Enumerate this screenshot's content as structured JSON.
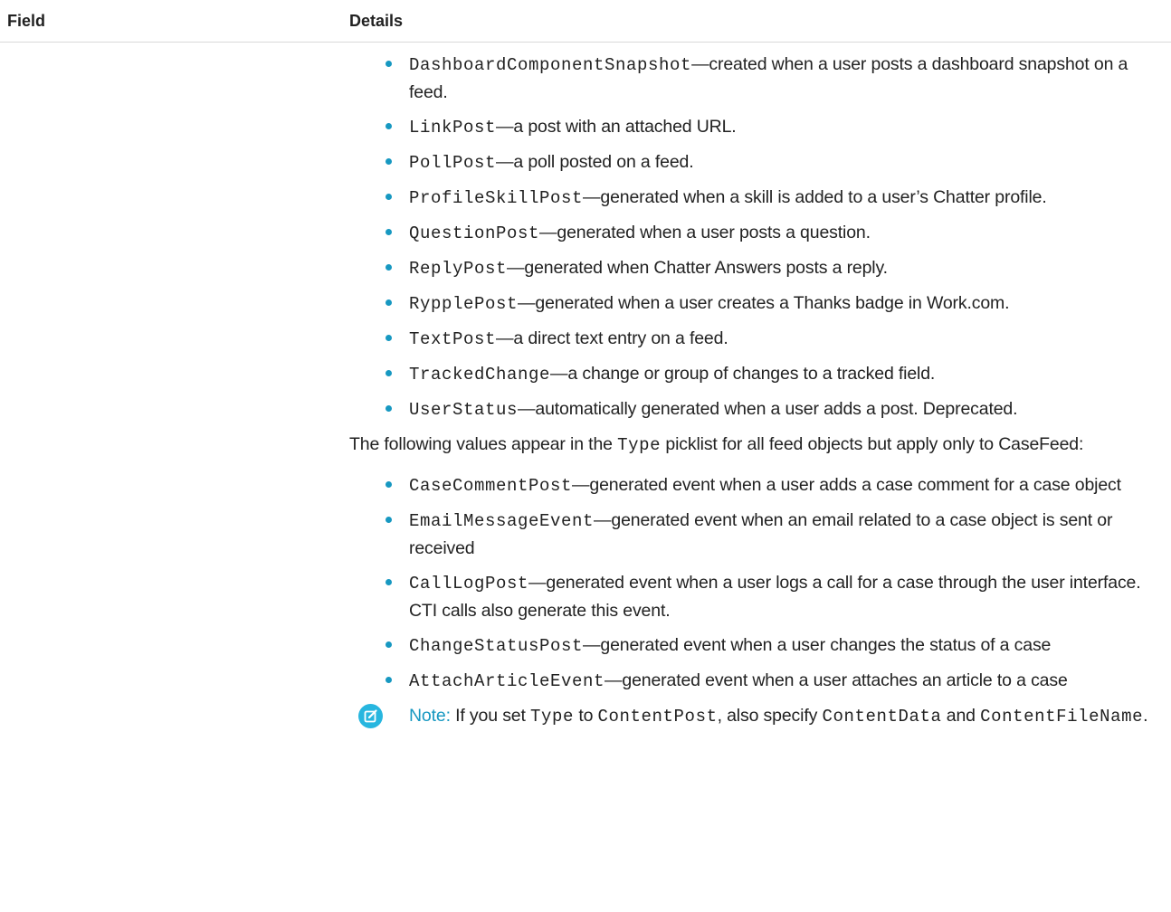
{
  "header": {
    "field_label": "Field",
    "details_label": "Details"
  },
  "list1": [
    {
      "code": "DashboardComponentSnapshot",
      "text": "—created when a user posts a dashboard snapshot on a feed."
    },
    {
      "code": "LinkPost",
      "text": "—a post with an attached URL."
    },
    {
      "code": "PollPost",
      "text": "—a poll posted on a feed."
    },
    {
      "code": "ProfileSkillPost",
      "text": "—generated when a skill is added to a user’s Chatter profile."
    },
    {
      "code": "QuestionPost",
      "text": "—generated when a user posts a question."
    },
    {
      "code": "ReplyPost",
      "text": "—generated when Chatter Answers posts a reply."
    },
    {
      "code": "RypplePost",
      "text": "—generated when a user creates a Thanks badge in Work.com."
    },
    {
      "code": "TextPost",
      "text": "—a direct text entry on a feed."
    },
    {
      "code": "TrackedChange",
      "text": "—a change or group of changes to a tracked field."
    },
    {
      "code": "UserStatus",
      "text": "—automatically generated when a user adds a post. Deprecated."
    }
  ],
  "paragraph": {
    "before": "The following values appear in the ",
    "code": "Type",
    "after": " picklist for all feed objects but apply only to CaseFeed:"
  },
  "list2": [
    {
      "code": "CaseCommentPost",
      "text": "—generated event when a user adds a case comment for a case object"
    },
    {
      "code": "EmailMessageEvent",
      "text": "—generated event when an email related to a case object is sent or received"
    },
    {
      "code": "CallLogPost",
      "text": "—generated event when a user logs a call for a case through the user interface. CTI calls also generate this event."
    },
    {
      "code": "ChangeStatusPost",
      "text": "—generated event when a user changes the status of a case"
    },
    {
      "code": "AttachArticleEvent",
      "text": "—generated event when a user attaches an article to a case"
    }
  ],
  "note": {
    "label": "Note:",
    "t1": " If you set ",
    "c1": "Type",
    "t2": " to ",
    "c2": "ContentPost",
    "t3": ", also specify ",
    "c3": "ContentData",
    "t4": " and ",
    "c4": "ContentFileName",
    "t5": ".",
    "icon_color": "#27b6df"
  },
  "colors": {
    "bullet": "#1798c1",
    "note_label": "#1798c1",
    "divider": "#d9d9d9"
  }
}
